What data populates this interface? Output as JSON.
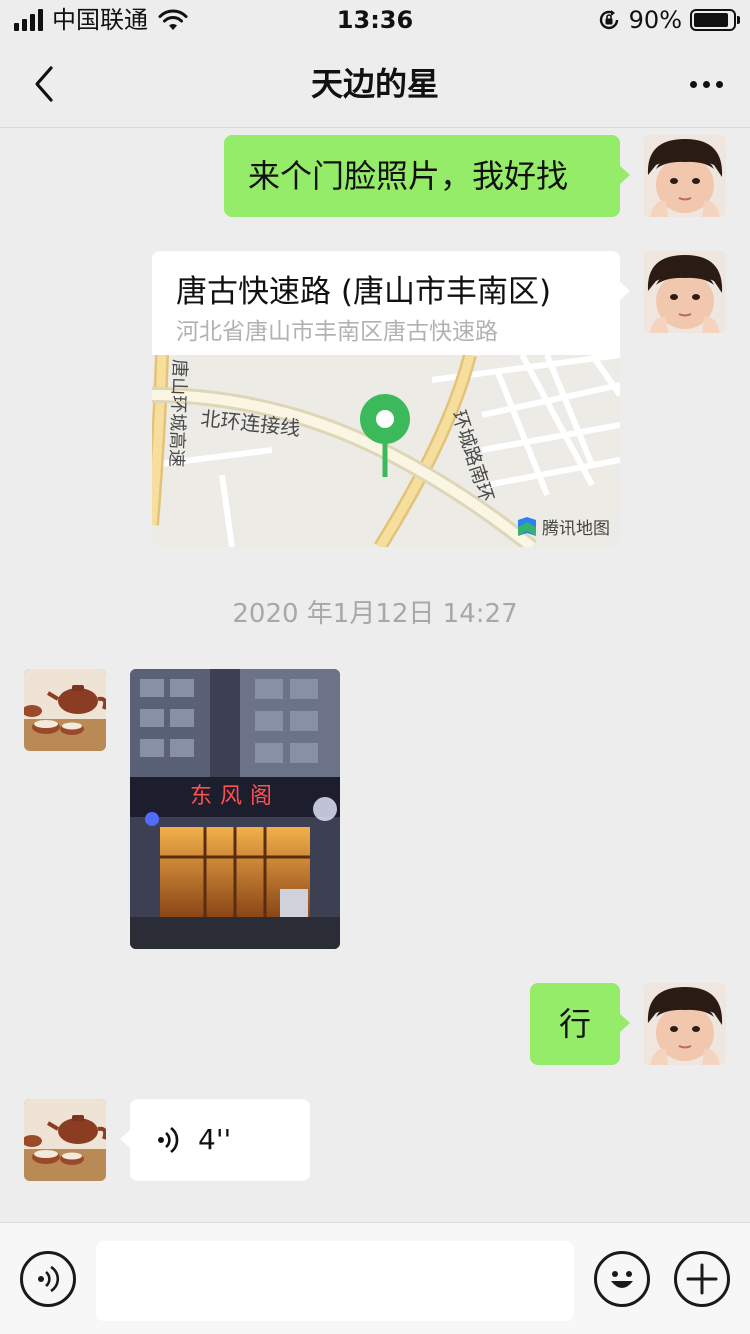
{
  "status_bar": {
    "carrier": "中国联通",
    "time": "13:36",
    "battery": "90%",
    "battery_level": 0.9
  },
  "header": {
    "title": "天边的星",
    "back_icon": "chevron-left-icon",
    "more_icon": "more-dots-icon"
  },
  "messages": {
    "m1": {
      "text": "来个门脸照片，我好找"
    },
    "m2": {
      "title": "唐古快速路 (唐山市丰南区)",
      "address": "河北省唐山市丰南区唐古快速路",
      "map_labels": [
        "北环连接线",
        "环城路南环",
        "唐山环城高速"
      ],
      "map_brand": "腾讯地图"
    },
    "timestamp": "2020 年1月12日 14:27",
    "m3": {
      "image_sign_text": "东风阁"
    },
    "m4": {
      "text": "行"
    },
    "m5": {
      "voice_duration": "4''"
    }
  },
  "input_bar": {
    "voice_icon": "voice-icon",
    "emoji_icon": "emoji-icon",
    "plus_icon": "plus-icon",
    "placeholder": ""
  },
  "colors": {
    "background": "#ededed",
    "own_bubble": "#95ec69",
    "other_bubble": "#ffffff",
    "map_pin": "#3cb95a"
  }
}
